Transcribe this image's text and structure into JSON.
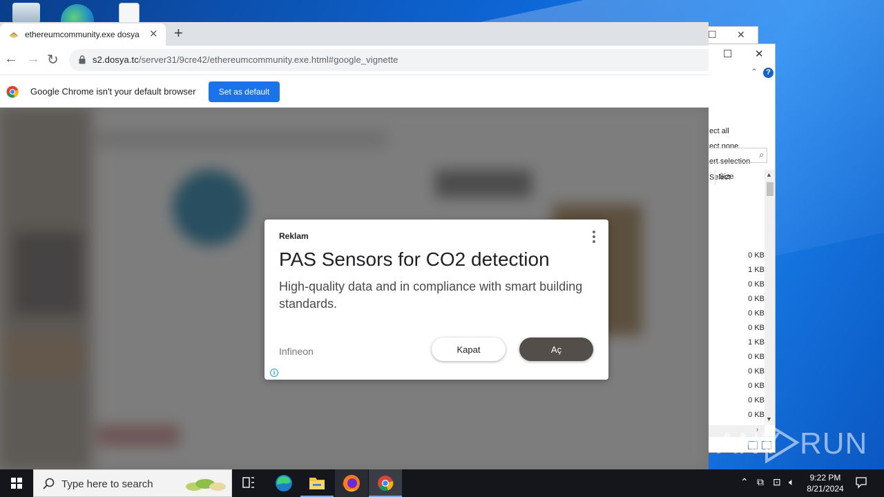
{
  "browser": {
    "tab_title": "ethereumcommunity.exe dosya",
    "url_host": "s2.dosya.tc",
    "url_path": "/server31/9cre42/ethereumcommunity.exe.html#google_vignette",
    "infobar_text": "Google Chrome isn't your default browser",
    "infobar_button": "Set as default"
  },
  "ad": {
    "label": "Reklam",
    "title": "PAS Sensors for CO2 detection",
    "description": "High-quality data and in compliance with smart building standards.",
    "advertiser": "Infineon",
    "close_button": "Kapat",
    "open_button": "Aç",
    "info_icon_glyph": "i"
  },
  "explorer": {
    "ribbon_items": [
      "ect all",
      "ect none",
      "ert selection",
      "Select"
    ],
    "column_header": "Size",
    "sizes": [
      "0 KB",
      "1 KB",
      "0 KB",
      "0 KB",
      "0 KB",
      "0 KB",
      "1 KB",
      "0 KB",
      "0 KB",
      "0 KB",
      "0 KB",
      "0 KB"
    ],
    "help_glyph": "?"
  },
  "taskbar": {
    "search_placeholder": "Type here to search",
    "time": "9:22 PM",
    "date": "8/21/2024"
  },
  "watermark": {
    "text_left": "ANY",
    "text_right": "RUN"
  },
  "colors": {
    "chrome_blue": "#1a73e8",
    "ad_open_bg": "#544e4a",
    "taskbar_bg": "#14161c"
  }
}
